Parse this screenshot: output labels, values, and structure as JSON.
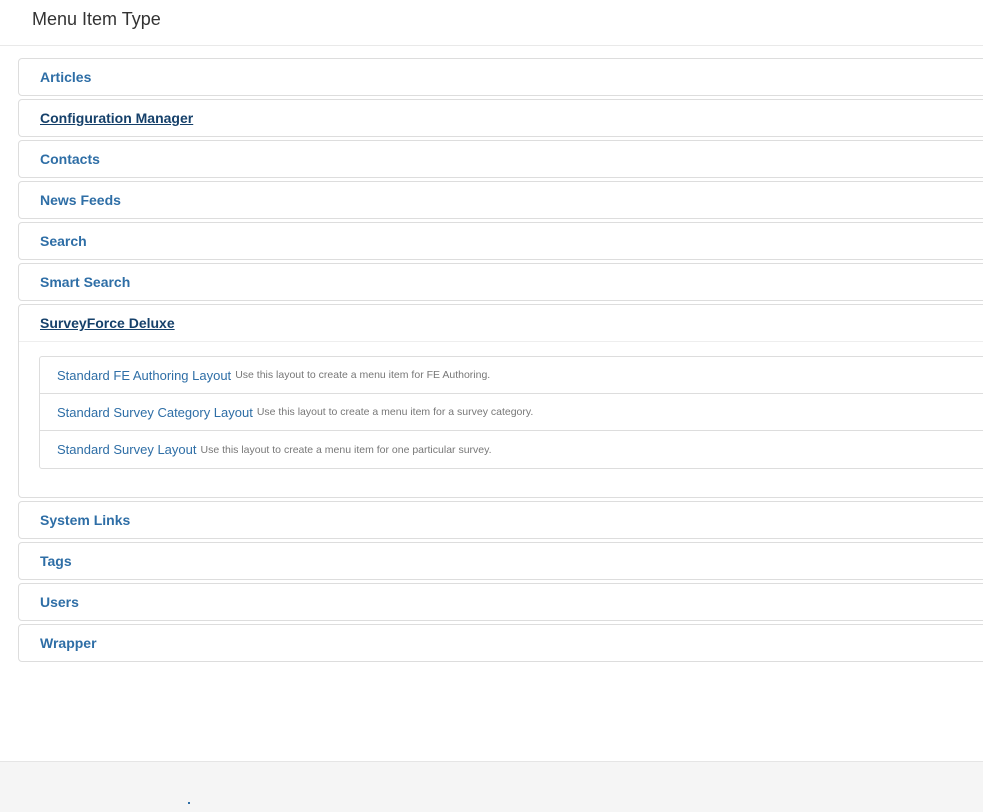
{
  "header": {
    "title": "Menu Item Type"
  },
  "accordion": {
    "groups_before": [
      {
        "label": "Articles"
      },
      {
        "label": "Configuration Manager"
      },
      {
        "label": "Contacts"
      },
      {
        "label": "News Feeds"
      },
      {
        "label": "Search"
      },
      {
        "label": "Smart Search"
      }
    ],
    "expanded": {
      "label": "SurveyForce Deluxe",
      "items": [
        {
          "title": "Standard FE Authoring Layout",
          "description": "Use this layout to create a menu item for FE Authoring."
        },
        {
          "title": "Standard Survey Category Layout",
          "description": "Use this layout to create a menu item for a survey category."
        },
        {
          "title": "Standard Survey Layout",
          "description": "Use this layout to create a menu item for one particular survey."
        }
      ]
    },
    "groups_after": [
      {
        "label": "System Links"
      },
      {
        "label": "Tags"
      },
      {
        "label": "Users"
      },
      {
        "label": "Wrapper"
      }
    ]
  },
  "colors": {
    "link": "#2e6ea6",
    "link_hover": "#15406a",
    "border": "#dddddd",
    "footer_bg": "#f5f5f5"
  }
}
